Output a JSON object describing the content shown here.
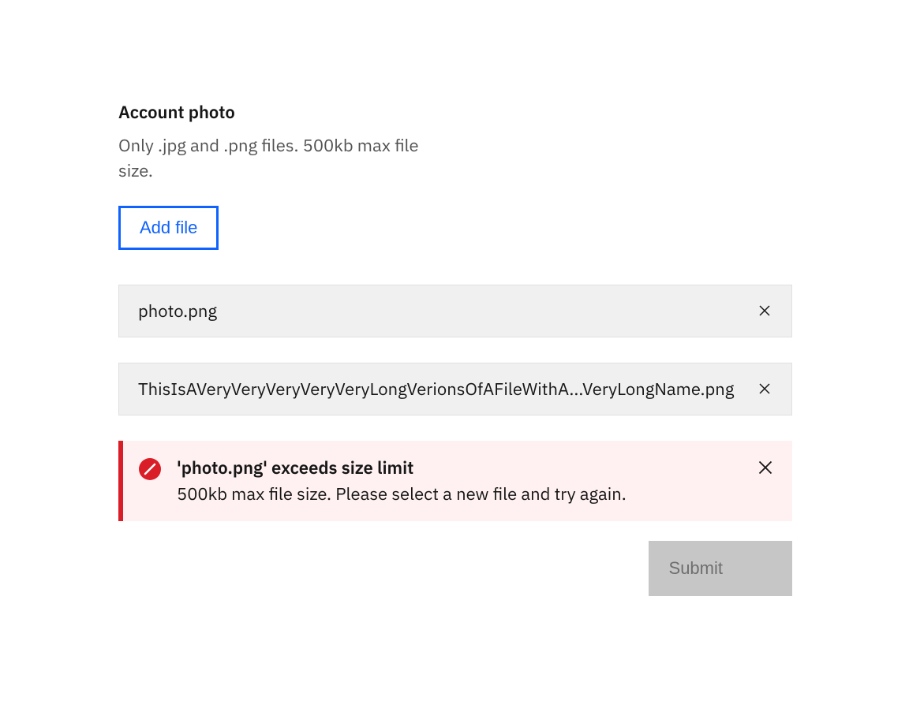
{
  "header": {
    "title": "Account photo",
    "subtitle": "Only .jpg and .png files. 500kb max file size."
  },
  "add_file_label": "Add file",
  "files": [
    {
      "name": "photo.png"
    },
    {
      "name": "ThisIsAVeryVeryVeryVeryVeryLongVerionsOfAFileWithA...VeryLongName.png"
    }
  ],
  "error": {
    "title": "'photo.png' exceeds size limit",
    "message": "500kb max file size. Please select a new file and try again."
  },
  "submit_label": "Submit",
  "colors": {
    "primary": "#0f62fe",
    "error": "#da1e28",
    "error_bg": "#fff1f1",
    "gray_bg": "#f0f0f0",
    "disabled_bg": "#c6c6c6",
    "text": "#161616",
    "text_secondary": "#525252"
  }
}
